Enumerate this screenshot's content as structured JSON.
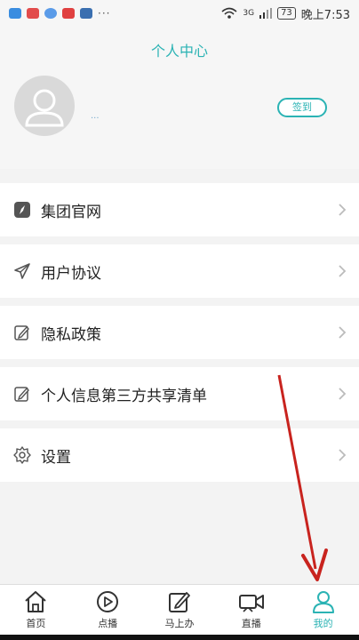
{
  "status": {
    "network": "3G",
    "battery": "73",
    "time": "晚上7:53"
  },
  "header": {
    "title": "个人中心",
    "username": "...",
    "checkin_label": "签到"
  },
  "menu": [
    {
      "label": "集团官网",
      "icon": "compass-icon"
    },
    {
      "label": "用户协议",
      "icon": "paper-plane-icon"
    },
    {
      "label": "隐私政策",
      "icon": "edit-icon"
    },
    {
      "label": "个人信息第三方共享清单",
      "icon": "edit-icon"
    },
    {
      "label": "设置",
      "icon": "gear-icon"
    }
  ],
  "tabs": [
    {
      "label": "首页",
      "icon": "home-icon"
    },
    {
      "label": "点播",
      "icon": "play-icon"
    },
    {
      "label": "马上办",
      "icon": "pen-square-icon"
    },
    {
      "label": "直播",
      "icon": "video-camera-icon"
    },
    {
      "label": "我的",
      "icon": "user-icon",
      "active": true
    }
  ],
  "colors": {
    "accent": "#2bb3b4",
    "arrow": "#c8231e"
  }
}
